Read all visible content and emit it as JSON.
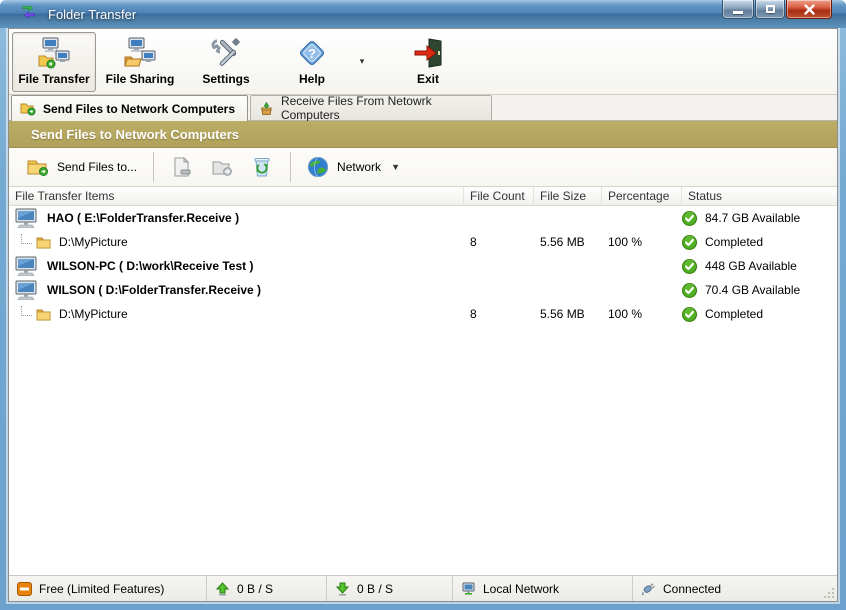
{
  "window": {
    "title": "Folder Transfer"
  },
  "titlebar": {
    "app_icon": "sync-arrows-icon",
    "buttons": {
      "minimize": "minimize",
      "maximize": "maximize",
      "close": "close"
    }
  },
  "toolbar": {
    "items": [
      {
        "label": "File Transfer",
        "icon": "file-transfer-icon",
        "selected": true
      },
      {
        "label": "File Sharing",
        "icon": "file-sharing-icon",
        "selected": false
      },
      {
        "label": "Settings",
        "icon": "settings-tools-icon",
        "selected": false
      },
      {
        "label": "Help",
        "icon": "help-diamond-icon",
        "selected": false,
        "has_dropdown": true
      },
      {
        "label": "Exit",
        "icon": "exit-door-icon",
        "selected": false
      }
    ]
  },
  "tabs": [
    {
      "label": "Send Files to Network Computers",
      "icon": "send-folder-icon",
      "active": true
    },
    {
      "label": "Receive Files From Netowrk Computers",
      "icon": "receive-box-icon",
      "active": false
    }
  ],
  "section_header": {
    "title": "Send Files to Network Computers"
  },
  "actionbar": {
    "send_button_label": "Send Files to...",
    "send_button_icon": "send-folder-icon",
    "icons": [
      "remove-file-icon",
      "remove-folder-icon",
      "refresh-bin-icon"
    ],
    "network_label": "Network",
    "network_icon": "globe-icon"
  },
  "list": {
    "columns": [
      "File Transfer Items",
      "File Count",
      "File Size",
      "Percentage",
      "Status"
    ],
    "rows": [
      {
        "type": "computer",
        "name": "HAO ( E:\\FolderTransfer.Receive )",
        "file_count": "",
        "file_size": "",
        "percentage": "",
        "status": "84.7 GB Available",
        "status_icon": "green-check-icon"
      },
      {
        "type": "folder",
        "name": "D:\\MyPicture",
        "file_count": "8",
        "file_size": "5.56 MB",
        "percentage": "100 %",
        "status": "Completed",
        "status_icon": "green-check-icon"
      },
      {
        "type": "computer",
        "name": "WILSON-PC ( D:\\work\\Receive Test )",
        "file_count": "",
        "file_size": "",
        "percentage": "",
        "status": "448 GB Available",
        "status_icon": "green-check-icon"
      },
      {
        "type": "computer",
        "name": "WILSON ( D:\\FolderTransfer.Receive )",
        "file_count": "",
        "file_size": "",
        "percentage": "",
        "status": "70.4 GB Available",
        "status_icon": "green-check-icon"
      },
      {
        "type": "folder",
        "name": "D:\\MyPicture",
        "file_count": "8",
        "file_size": "5.56 MB",
        "percentage": "100 %",
        "status": "Completed",
        "status_icon": "green-check-icon"
      }
    ]
  },
  "statusbar": {
    "segments": [
      {
        "icon": "license-icon",
        "label": "Free (Limited Features)"
      },
      {
        "icon": "upload-arrow-icon",
        "label": "0 B / S"
      },
      {
        "icon": "download-arrow-icon",
        "label": "0 B / S"
      },
      {
        "icon": "network-monitor-icon",
        "label": "Local Network"
      },
      {
        "icon": "plug-icon",
        "label": "Connected"
      }
    ]
  },
  "colors": {
    "titlebar_blue": "#4d82b5",
    "gold_header": "#b3a45e",
    "check_green": "#4fae1f",
    "close_red": "#c2512f",
    "folder_yellow": "#f2c94c"
  }
}
